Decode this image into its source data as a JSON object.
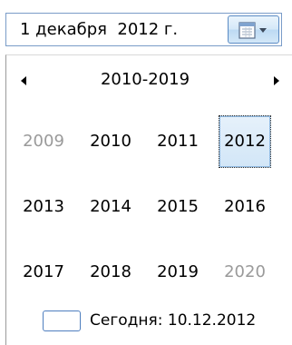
{
  "date_field": {
    "value": "1 декабря  2012 г."
  },
  "calendar": {
    "decade_header": "2010-2019",
    "years": [
      {
        "label": "2009",
        "muted": true,
        "selected": false
      },
      {
        "label": "2010",
        "muted": false,
        "selected": false
      },
      {
        "label": "2011",
        "muted": false,
        "selected": false
      },
      {
        "label": "2012",
        "muted": false,
        "selected": true
      },
      {
        "label": "2013",
        "muted": false,
        "selected": false
      },
      {
        "label": "2014",
        "muted": false,
        "selected": false
      },
      {
        "label": "2015",
        "muted": false,
        "selected": false
      },
      {
        "label": "2016",
        "muted": false,
        "selected": false
      },
      {
        "label": "2017",
        "muted": false,
        "selected": false
      },
      {
        "label": "2018",
        "muted": false,
        "selected": false
      },
      {
        "label": "2019",
        "muted": false,
        "selected": false
      },
      {
        "label": "2020",
        "muted": true,
        "selected": false
      }
    ],
    "today_label": "Сегодня: 10.12.2012"
  },
  "icons": {
    "prev": "triangle-left-icon",
    "next": "triangle-right-icon",
    "dropdown": "calendar-icon",
    "today": "today-box-icon"
  },
  "colors": {
    "muted_text": "#9a9a9a",
    "accent_border": "#4f7fbf",
    "selected_bg": "#d2e6f7"
  }
}
